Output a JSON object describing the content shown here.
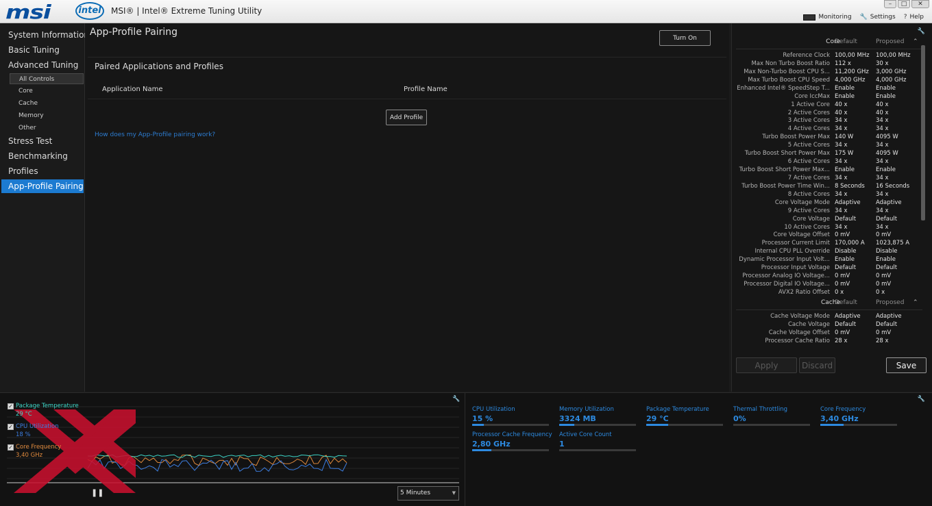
{
  "titlebar": {
    "brand": "msi",
    "intel": "intel",
    "title": "MSI® | Intel® Extreme Tuning Utility",
    "menu": [
      {
        "icon": "monitor-icon",
        "label": "Monitoring"
      },
      {
        "icon": "wrench-icon",
        "label": "Settings"
      },
      {
        "icon": "help-icon",
        "label": "Help"
      }
    ]
  },
  "sidebar": {
    "items": [
      {
        "label": "System Information"
      },
      {
        "label": "Basic Tuning"
      },
      {
        "label": "Advanced Tuning"
      },
      {
        "label": "Stress Test"
      },
      {
        "label": "Benchmarking"
      },
      {
        "label": "Profiles"
      },
      {
        "label": "App-Profile Pairing"
      }
    ],
    "sub_items": [
      {
        "label": "All Controls"
      },
      {
        "label": "Core"
      },
      {
        "label": "Cache"
      },
      {
        "label": "Memory"
      },
      {
        "label": "Other"
      }
    ]
  },
  "main": {
    "title": "App-Profile Pairing",
    "turn_on": "Turn On",
    "section": "Paired Applications and Profiles",
    "col_app": "Application Name",
    "col_profile": "Profile Name",
    "add_profile": "Add Profile",
    "help_link": "How does my App-Profile pairing work?"
  },
  "panel": {
    "core_group": {
      "name": "Core",
      "default": "Default",
      "proposed": "Proposed"
    },
    "cache_group": {
      "name": "Cache",
      "default": "Default",
      "proposed": "Proposed"
    },
    "core_rows": [
      {
        "n": "Reference Clock",
        "d": "100,00 MHz",
        "p": "100,00 MHz"
      },
      {
        "n": "Max Non Turbo Boost Ratio",
        "d": "112 x",
        "p": "30 x"
      },
      {
        "n": "Max Non-Turbo Boost CPU S...",
        "d": "11,200 GHz",
        "p": "3,000 GHz"
      },
      {
        "n": "Max Turbo Boost CPU Speed",
        "d": "4,000 GHz",
        "p": "4,000 GHz"
      },
      {
        "n": "Enhanced Intel® SpeedStep T...",
        "d": "Enable",
        "p": "Enable"
      },
      {
        "n": "Core IccMax",
        "d": "Enable",
        "p": "Enable"
      },
      {
        "n": "1 Active Core",
        "d": "40 x",
        "p": "40 x"
      },
      {
        "n": "2 Active Cores",
        "d": "40 x",
        "p": "40 x"
      },
      {
        "n": "3 Active Cores",
        "d": "34 x",
        "p": "34 x"
      },
      {
        "n": "4 Active Cores",
        "d": "34 x",
        "p": "34 x"
      },
      {
        "n": "Turbo Boost Power Max",
        "d": "140 W",
        "p": "4095 W"
      },
      {
        "n": "5 Active Cores",
        "d": "34 x",
        "p": "34 x"
      },
      {
        "n": "Turbo Boost Short Power Max",
        "d": "175 W",
        "p": "4095 W"
      },
      {
        "n": "6 Active Cores",
        "d": "34 x",
        "p": "34 x"
      },
      {
        "n": "Turbo Boost Short Power Max...",
        "d": "Enable",
        "p": "Enable"
      },
      {
        "n": "7 Active Cores",
        "d": "34 x",
        "p": "34 x"
      },
      {
        "n": "Turbo Boost Power Time Win...",
        "d": "8 Seconds",
        "p": "16 Seconds"
      },
      {
        "n": "8 Active Cores",
        "d": "34 x",
        "p": "34 x"
      },
      {
        "n": "Core Voltage Mode",
        "d": "Adaptive",
        "p": "Adaptive"
      },
      {
        "n": "9 Active Cores",
        "d": "34 x",
        "p": "34 x"
      },
      {
        "n": "Core Voltage",
        "d": "Default",
        "p": "Default"
      },
      {
        "n": "10 Active Cores",
        "d": "34 x",
        "p": "34 x"
      },
      {
        "n": "Core Voltage Offset",
        "d": "0 mV",
        "p": "0 mV"
      },
      {
        "n": "Processor Current Limit",
        "d": "170,000 A",
        "p": "1023,875 A"
      },
      {
        "n": "Internal CPU PLL Override",
        "d": "Disable",
        "p": "Disable"
      },
      {
        "n": "Dynamic Processor Input Volt...",
        "d": "Enable",
        "p": "Enable"
      },
      {
        "n": "Processor Input Voltage",
        "d": "Default",
        "p": "Default"
      },
      {
        "n": "Processor Analog IO Voltage...",
        "d": "0 mV",
        "p": "0 mV"
      },
      {
        "n": "Processor Digital IO Voltage...",
        "d": "0 mV",
        "p": "0 mV"
      },
      {
        "n": "AVX2 Ratio Offset",
        "d": "0 x",
        "p": "0 x"
      }
    ],
    "cache_rows": [
      {
        "n": "Cache Voltage Mode",
        "d": "Adaptive",
        "p": "Adaptive"
      },
      {
        "n": "Cache Voltage",
        "d": "Default",
        "p": "Default"
      },
      {
        "n": "Cache Voltage Offset",
        "d": "0 mV",
        "p": "0 mV"
      },
      {
        "n": "Processor Cache Ratio",
        "d": "28 x",
        "p": "28 x"
      }
    ],
    "apply": "Apply",
    "discard": "Discard",
    "save": "Save"
  },
  "monitor": {
    "legend": [
      {
        "label": "Package Temperature",
        "value": "29 °C",
        "color": "#3dd6c8"
      },
      {
        "label": "CPU Utilization",
        "value": "18 %",
        "color": "#3d7ee0"
      },
      {
        "label": "Core Frequency",
        "value": "3,40 GHz",
        "color": "#e08a3d"
      }
    ],
    "duration": "5 Minutes",
    "stats": [
      {
        "label": "CPU Utilization",
        "value": "15 %",
        "fill": 0.15
      },
      {
        "label": "Memory Utilization",
        "value": "3324  MB",
        "fill": 0.2
      },
      {
        "label": "Package Temperature",
        "value": "29 °C",
        "fill": 0.29
      },
      {
        "label": "Thermal Throttling",
        "value": "0%",
        "fill": 0
      },
      {
        "label": "Core Frequency",
        "value": "3,40 GHz",
        "fill": 0.3
      },
      {
        "label": "Processor Cache Frequency",
        "value": "2,80 GHz",
        "fill": 0.25
      },
      {
        "label": "Active Core Count",
        "value": "1",
        "fill": 0
      }
    ]
  },
  "colors": {
    "accent": "#1c7bd1",
    "link": "#2d7dd2",
    "watermark": "#c8102e"
  }
}
